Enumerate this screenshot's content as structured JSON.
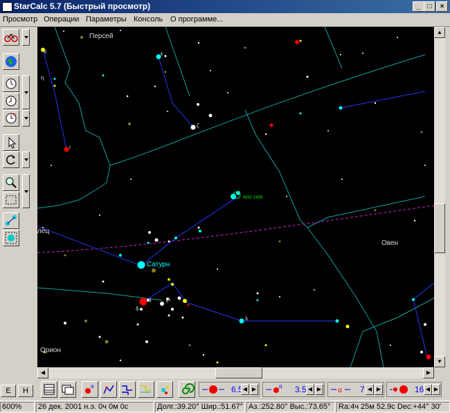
{
  "window": {
    "title": "StarCalc 5.7 (Быстрый просмотр)"
  },
  "menu": {
    "items": [
      "Просмотр",
      "Операции",
      "Параметры",
      "Консоль",
      "О программе..."
    ]
  },
  "sky": {
    "constellations": [
      "Персей",
      "Овен",
      "Орион",
      "лец"
    ],
    "labels": {
      "saturn": "Сатурн",
      "ngc": "NGC 1435"
    },
    "greek": [
      "ε",
      "η",
      "ζ",
      "ι",
      "α",
      "λ",
      "ε",
      "δ",
      "ε²"
    ],
    "colors": {
      "background": "#000000",
      "boundary": "#0fa3a3",
      "lines": "#1e2fd0",
      "ecliptic": "#d020d0",
      "saturn": "#00ffff",
      "ngc_label": "#00ff00"
    }
  },
  "bottom": {
    "buttons": [
      "E",
      "H"
    ],
    "spinners": [
      "6.5",
      "3.5",
      "7",
      "16"
    ]
  },
  "status": {
    "zoom": "600%",
    "date": "26 дек. 2001 н.э. 0ч 0м 0с",
    "coords": "Долг.:39.20° Шир.:51.67°",
    "azalt": "Аз.:252.80° Выс.:73.65°",
    "radec": "Ra:4ч 25м 52.9с Dec:+44° 30'"
  }
}
